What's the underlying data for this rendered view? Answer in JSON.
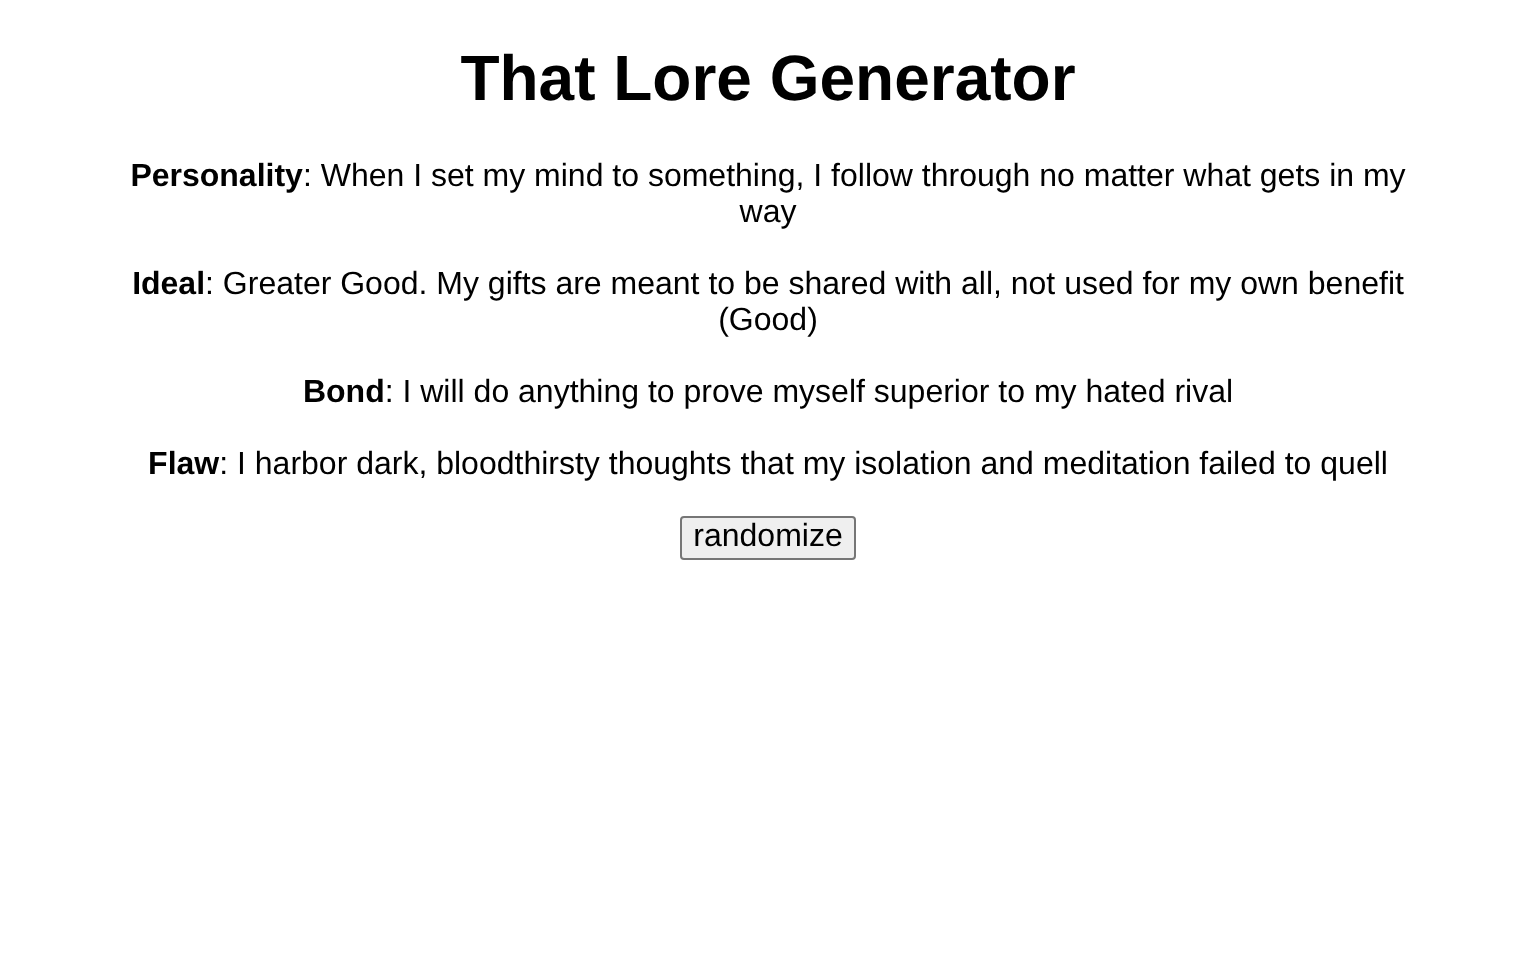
{
  "title": "That Lore Generator",
  "traits": [
    "**Personality**: When I set my mind to something, I follow through no matter what gets in my way",
    "**Ideal**: Greater Good. My gifts are meant to be shared with all, not used for my own benefit (Good)",
    "**Bond**: I will do anything to prove myself superior to my hated rival",
    "**Flaw**: I harbor dark, bloodthirsty thoughts that my isolation and meditation failed to quell"
  ],
  "button": "randomize"
}
